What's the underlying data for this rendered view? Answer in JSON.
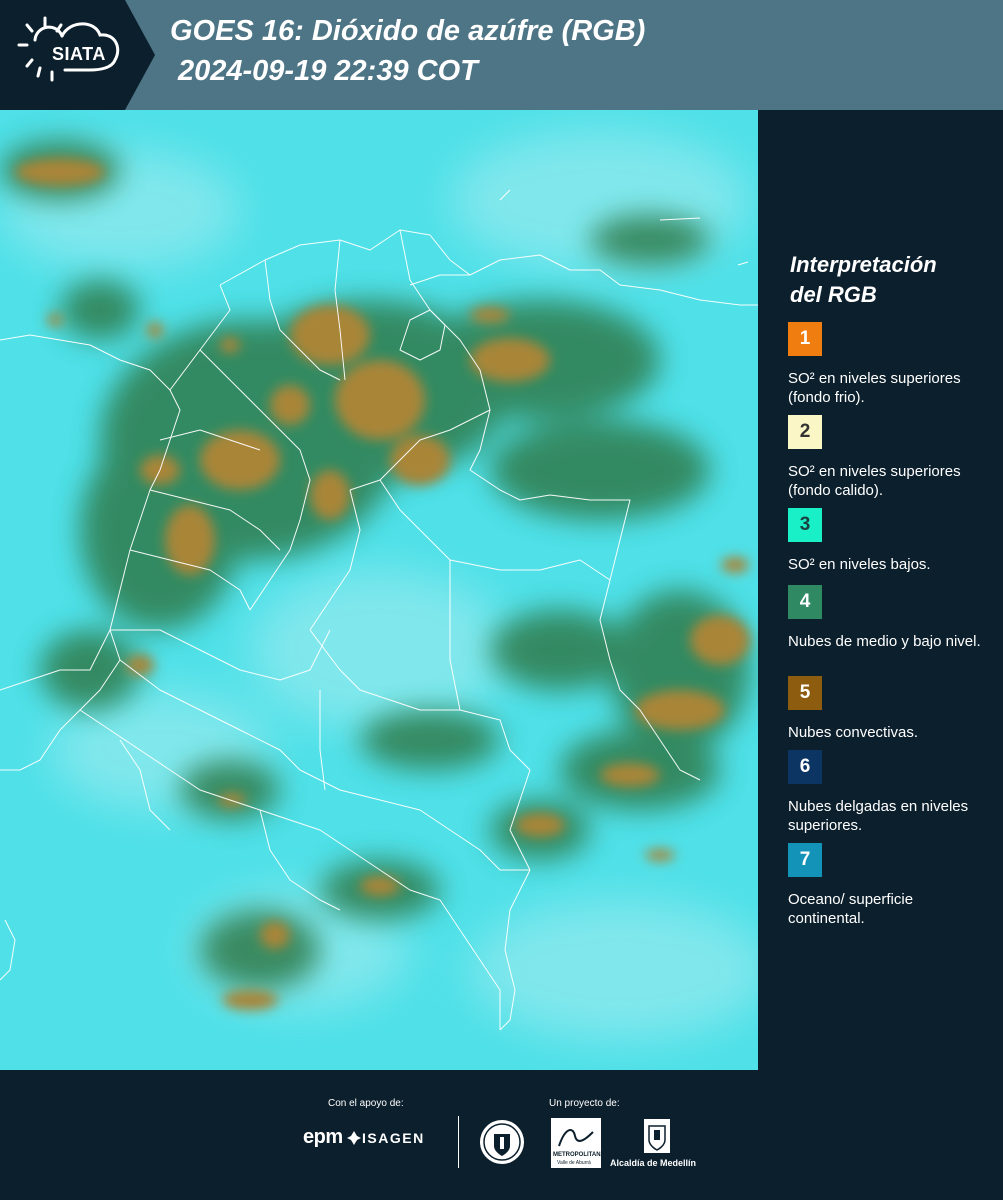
{
  "header": {
    "logo_text": "SIATA",
    "title_line1": "GOES 16: Dióxido de azúfre (RGB)",
    "title_line2": "2024-09-19 22:39 COT"
  },
  "legend": {
    "title_line1": "Interpretación",
    "title_line2": "del RGB",
    "items": [
      {
        "number": "1",
        "color": "#f07d10",
        "text_color": "#ffffff",
        "text": "SO² en niveles superiores (fondo frio)."
      },
      {
        "number": "2",
        "color": "#fbf6c6",
        "text_color": "#333333",
        "text": "SO² en niveles superiores (fondo calido)."
      },
      {
        "number": "3",
        "color": "#19f0c8",
        "text_color": "#1a4040",
        "text": "SO² en niveles bajos."
      },
      {
        "number": "4",
        "color": "#2f8a64",
        "text_color": "#ffffff",
        "text": "Nubes de medio y bajo nivel."
      },
      {
        "number": "5",
        "color": "#8e5c0f",
        "text_color": "#ffffff",
        "text": "Nubes convectivas."
      },
      {
        "number": "6",
        "color": "#0c3564",
        "text_color": "#ffffff",
        "text": "Nubes delgadas en niveles superiores."
      },
      {
        "number": "7",
        "color": "#1493b8",
        "text_color": "#ffffff",
        "text": "Oceano/ superficie continental."
      }
    ]
  },
  "footer": {
    "support_label": "Con el apoyo de:",
    "project_label": "Un proyecto de:",
    "sponsor1": "epm",
    "sponsor2": "ISAGEN",
    "partner_area_line1": "METROPOLITANA",
    "partner_area_line2": "Valle de Aburrá",
    "partner_alcaldia": "Alcaldía de Medellín"
  },
  "map": {
    "background_color": "#4fe0e8",
    "cloud_low_color": "#2e7a4a",
    "cloud_convective_color": "#a88538",
    "border_color": "#ffffff"
  }
}
